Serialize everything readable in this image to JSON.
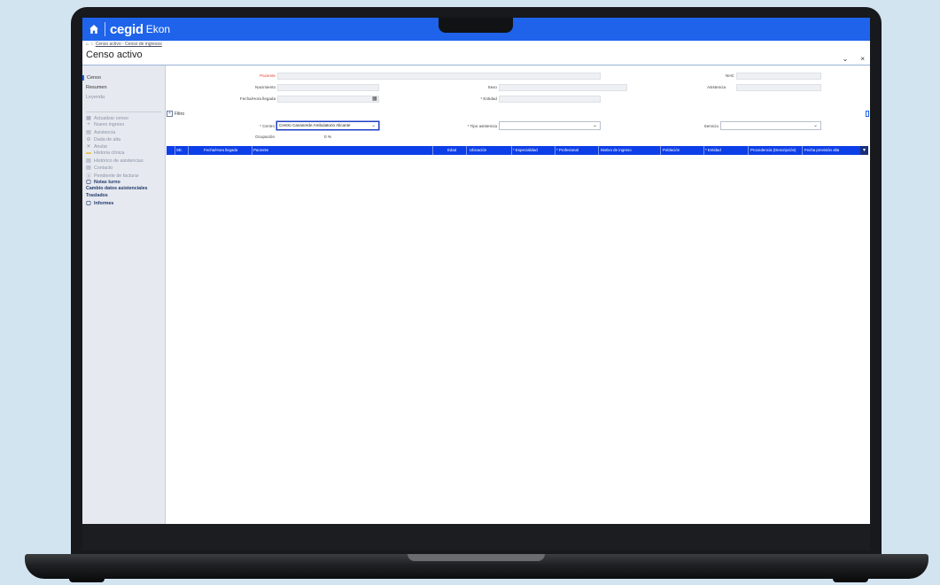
{
  "app": {
    "brand": "cegid",
    "product": "Ekon"
  },
  "breadcrumb": {
    "home_icon": "home-icon",
    "separator": "›",
    "path": "Censo activo - Censo de ingresos"
  },
  "page": {
    "title": "Censo activo",
    "minimize": "⌄",
    "close": "×"
  },
  "sidebar": {
    "tabs": [
      "Censo",
      "Resumen",
      "Leyenda"
    ],
    "actions": [
      {
        "icon": "refresh-icon",
        "glyph": "▦",
        "label": "Actualizar censo"
      },
      {
        "icon": "plus-icon",
        "glyph": "+",
        "label": "Nuevo ingreso"
      },
      {
        "icon": "document-icon",
        "glyph": "▤",
        "label": "Asistencia"
      },
      {
        "icon": "discharge-icon",
        "glyph": "⊖",
        "label": "Dada de alta"
      },
      {
        "icon": "cancel-icon",
        "glyph": "✕",
        "label": "Anular"
      },
      {
        "icon": "folder-icon",
        "glyph": "▬",
        "label": "Historia clínica"
      },
      {
        "icon": "history-icon",
        "glyph": "▤",
        "label": "Histórico de asistencias"
      },
      {
        "icon": "contact-icon",
        "glyph": "▤",
        "label": "Contacto"
      },
      {
        "icon": "billing-icon",
        "glyph": "ⓐ",
        "label": "Pendiente de facturar"
      },
      {
        "icon": "notes-icon",
        "glyph": "▢",
        "label": "Notas turno"
      }
    ],
    "links": [
      "Cambio datos asistenciales",
      "Traslados"
    ],
    "reports": {
      "icon": "reports-icon",
      "glyph": "▢",
      "label": "Informes"
    }
  },
  "patient": {
    "paciente_label": "Paciente",
    "nhc_label": "NHC",
    "nacimiento_label": "Nacimiento",
    "sexo_label": "Sexo",
    "asistencia_label": "Asistencia",
    "fecha_label": "Fecha/Hora llegada",
    "entidad_label": "* Entidad"
  },
  "filters": {
    "toggle_label": "Filtro",
    "toggle_glyph": "+",
    "centro_label": "* Centro",
    "centro_value": "Centro Cavanerde Ambulatorio Alicante",
    "tipo_label": "* Tipo asistencia",
    "tipo_value": "",
    "servicio_label": "Servicio",
    "servicio_value": "",
    "ocupacion_label": "Ocupación",
    "ocupacion_value": "0 %"
  },
  "table": {
    "columns": [
      "SE.",
      "Fecha/Hora llegada",
      "Paciente",
      "Edad",
      "Ubicación",
      "* Especialidad",
      "* Profesional",
      "Motivo de ingreso",
      "Población",
      "* Entidad",
      "Procedencia (Descripción)",
      "Fecha previsión alta"
    ],
    "rows": []
  },
  "colors": {
    "accent": "#1e63ea",
    "header": "#0d3fe8",
    "required": "#e0442b"
  }
}
